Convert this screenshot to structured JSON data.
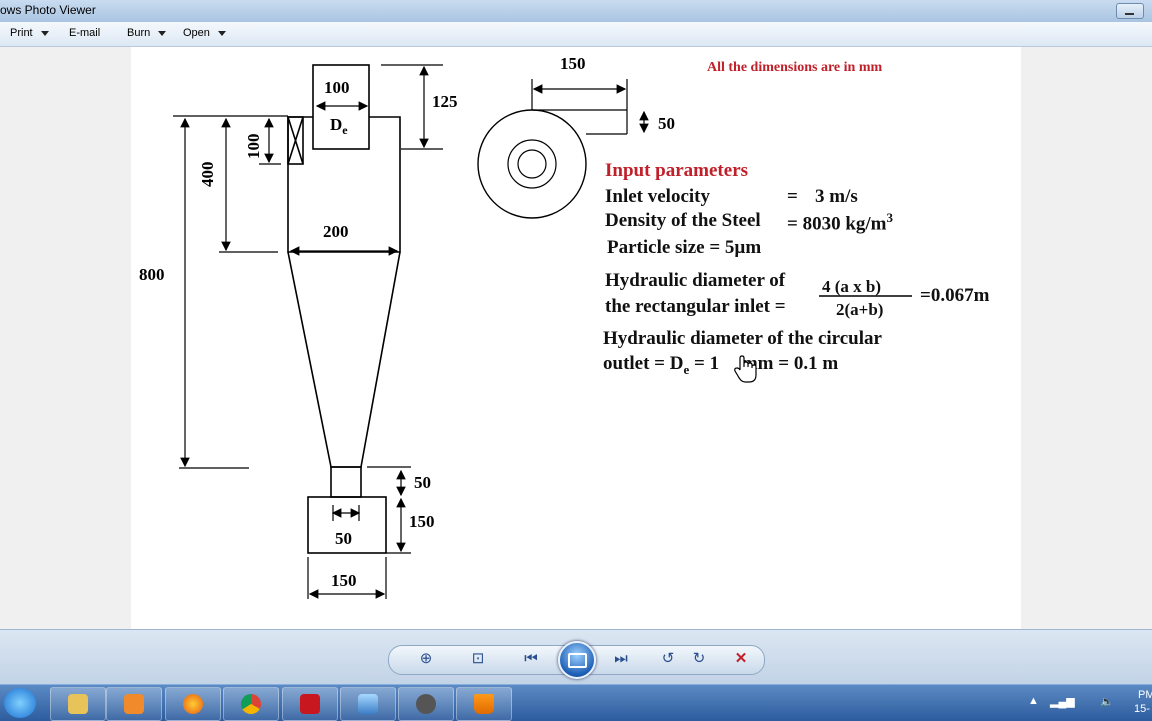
{
  "window": {
    "title": "ows Photo Viewer"
  },
  "menu": [
    {
      "label": "Print",
      "dropdown": true
    },
    {
      "label": "E-mail",
      "dropdown": false
    },
    {
      "label": "Burn",
      "dropdown": true
    },
    {
      "label": "Open",
      "dropdown": true
    }
  ],
  "drawing": {
    "note": "All the dimensions are in mm",
    "dims": {
      "outlet_width": "100",
      "outlet_label": "D",
      "outlet_sub": "e",
      "outlet_height_top": "125",
      "inlet_height": "100",
      "cylinder_height": "400",
      "total_height": "800",
      "body_diameter": "200",
      "dust_outlet_height": "50",
      "hopper_inner": "50",
      "hopper_height": "150",
      "hopper_width": "150",
      "top_inlet_length": "150",
      "top_inlet_height": "50"
    },
    "params": {
      "heading": "Input parameters",
      "velocity_label": "Inlet velocity",
      "velocity_eq": "=",
      "velocity_value": "3  m/s",
      "density_label": "Density of the Steel",
      "density_value": "= 8030 kg/m",
      "density_sup": "3",
      "particle": "Particle size = 5µm",
      "hyd_line1": "Hydraulic diameter of",
      "hyd_line2": "the rectangular inlet =",
      "hyd_num": "4 (a x b)",
      "hyd_den": "2(a+b)",
      "hyd_result": "=0.067m",
      "circ_line1": "Hydraulic diameter of the circular",
      "circ_line2_a": "outlet = D",
      "circ_line2_sub": "e",
      "circ_line2_b": " = 1",
      "circ_line2_c": " mm = 0.1 m"
    }
  },
  "colors": {
    "accent_red": "#c0202a",
    "taskbar": "#2d5c9e"
  },
  "controls": [
    "zoom-icon",
    "fit-window-icon",
    "previous-icon",
    "slideshow-icon",
    "next-icon",
    "rotate-left-icon",
    "rotate-right-icon",
    "delete-icon"
  ],
  "taskbar_apps": [
    "internet-explorer-icon",
    "file-explorer-icon",
    "media-player-icon",
    "firefox-icon",
    "chrome-icon",
    "acrobat-icon",
    "photo-viewer-icon",
    "microphone-app-icon",
    "vlc-icon"
  ],
  "tray": {
    "time_partial": "PM",
    "date_partial": "15-"
  }
}
